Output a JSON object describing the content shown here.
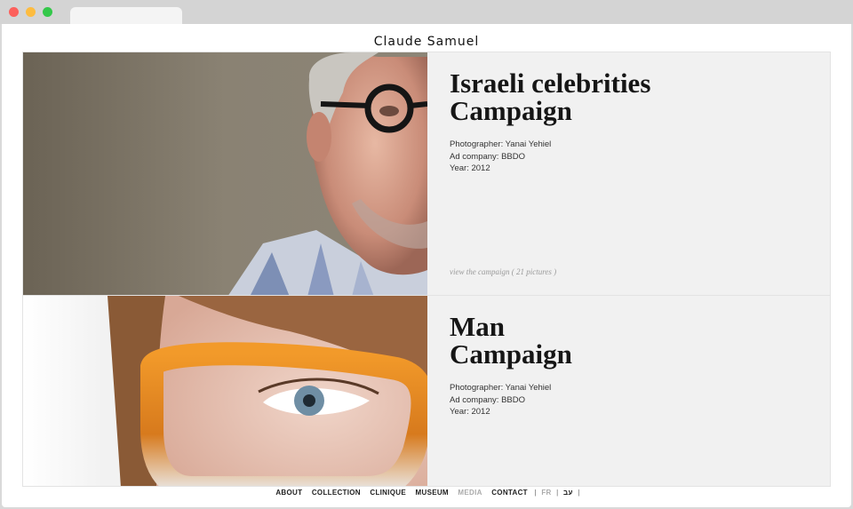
{
  "header": {
    "logo": "Claude Samuel"
  },
  "campaigns": [
    {
      "title_line1": "Israeli celebrities",
      "title_line2": "Campaign",
      "photographer": "Photographer: Yanai Yehiel",
      "ad_company": "Ad company: BBDO",
      "year": "Year: 2012",
      "view_link": "view the campaign ( 21 pictures )",
      "photo": "portrait-older-man-round-black-glasses"
    },
    {
      "title_line1": "Man",
      "title_line2": "Campaign",
      "photographer": "Photographer: Yanai Yehiel",
      "ad_company": "Ad company: BBDO",
      "year": "Year: 2012",
      "photo": "closeup-eye-orange-tortoise-glasses"
    }
  ],
  "nav": {
    "items": [
      "ABOUT",
      "COLLECTION",
      "CLINIQUE",
      "MUSEUM",
      "MEDIA",
      "CONTACT"
    ],
    "active": "MEDIA",
    "separator": "|",
    "lang_fr": "FR",
    "lang_he": "עב"
  },
  "colors": {
    "card_bg": "#f1f1f1",
    "title": "#161616",
    "link_muted": "#9a9a9a",
    "nav_inactive": "#aaaaaa"
  }
}
